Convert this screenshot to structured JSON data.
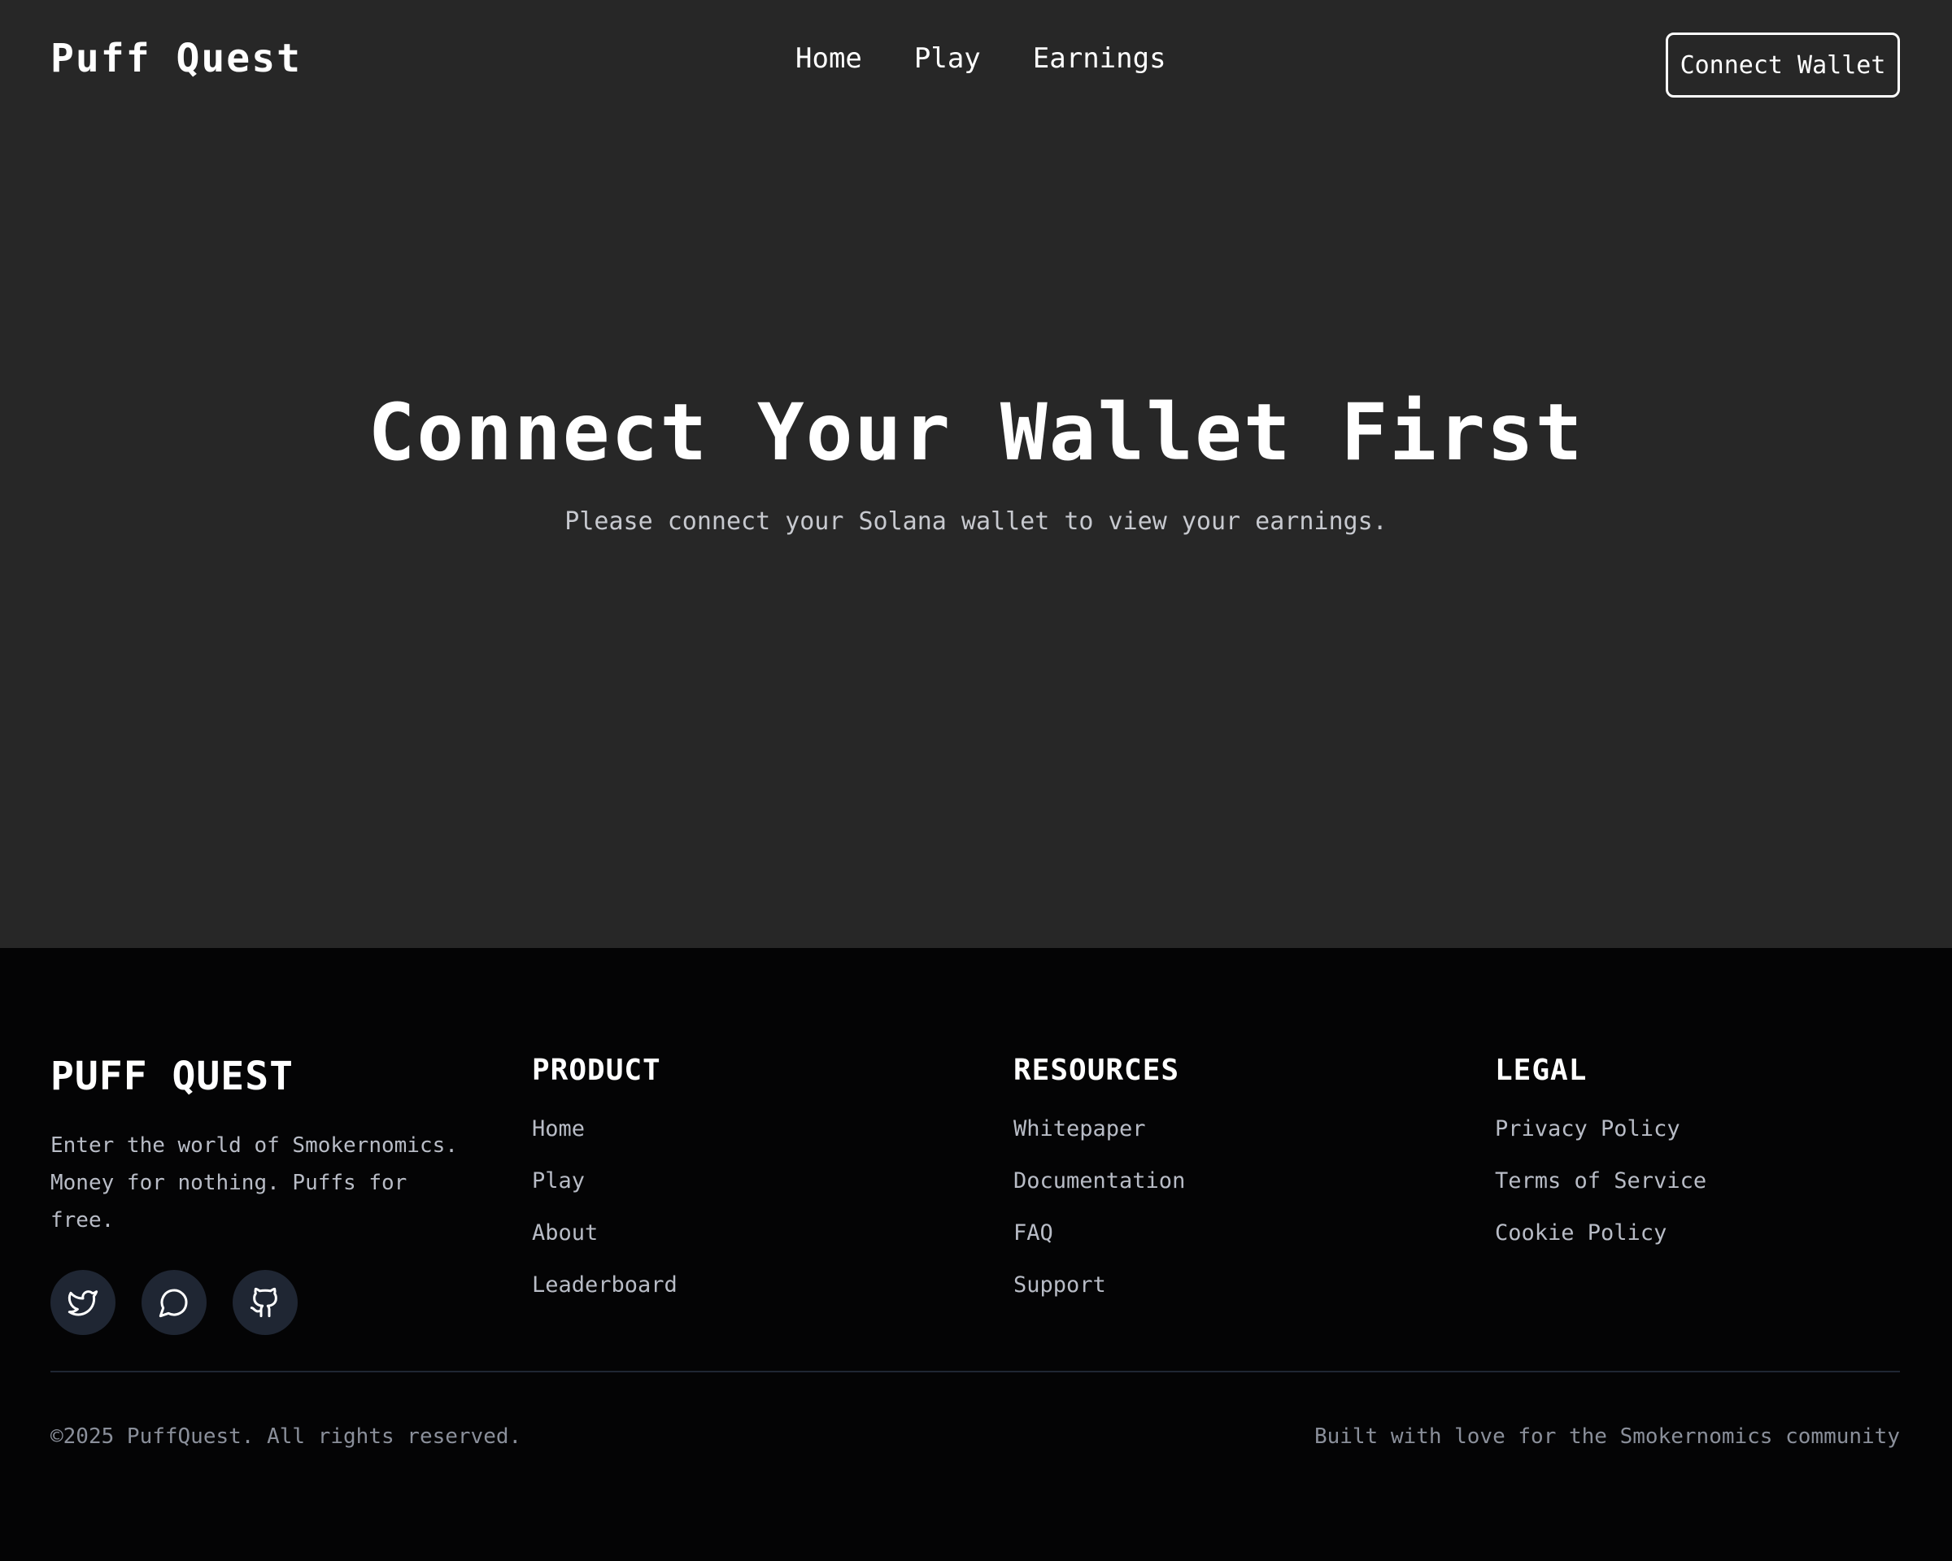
{
  "header": {
    "brand": "Puff Quest",
    "nav": [
      "Home",
      "Play",
      "Earnings"
    ],
    "connect_label": "Connect Wallet"
  },
  "main": {
    "title": "Connect Your Wallet First",
    "subtitle": "Please connect your Solana wallet to view your earnings."
  },
  "footer": {
    "brand": "PUFF QUEST",
    "tagline": "Enter the world of Smokernomics. Money for nothing. Puffs for free.",
    "socials": [
      "twitter-icon",
      "chat-icon",
      "github-icon"
    ],
    "columns": [
      {
        "heading": "PRODUCT",
        "links": [
          "Home",
          "Play",
          "About",
          "Leaderboard"
        ]
      },
      {
        "heading": "RESOURCES",
        "links": [
          "Whitepaper",
          "Documentation",
          "FAQ",
          "Support"
        ]
      },
      {
        "heading": "LEGAL",
        "links": [
          "Privacy Policy",
          "Terms of Service",
          "Cookie Policy"
        ]
      }
    ],
    "copyright": "©2025 PuffQuest. All rights reserved.",
    "built_with": "Built with love for the Smokernomics community"
  },
  "colors": {
    "page_bg": "#272727",
    "footer_bg": "#040405",
    "social_bg": "#1f2633",
    "muted_text": "#b8bcc6"
  }
}
